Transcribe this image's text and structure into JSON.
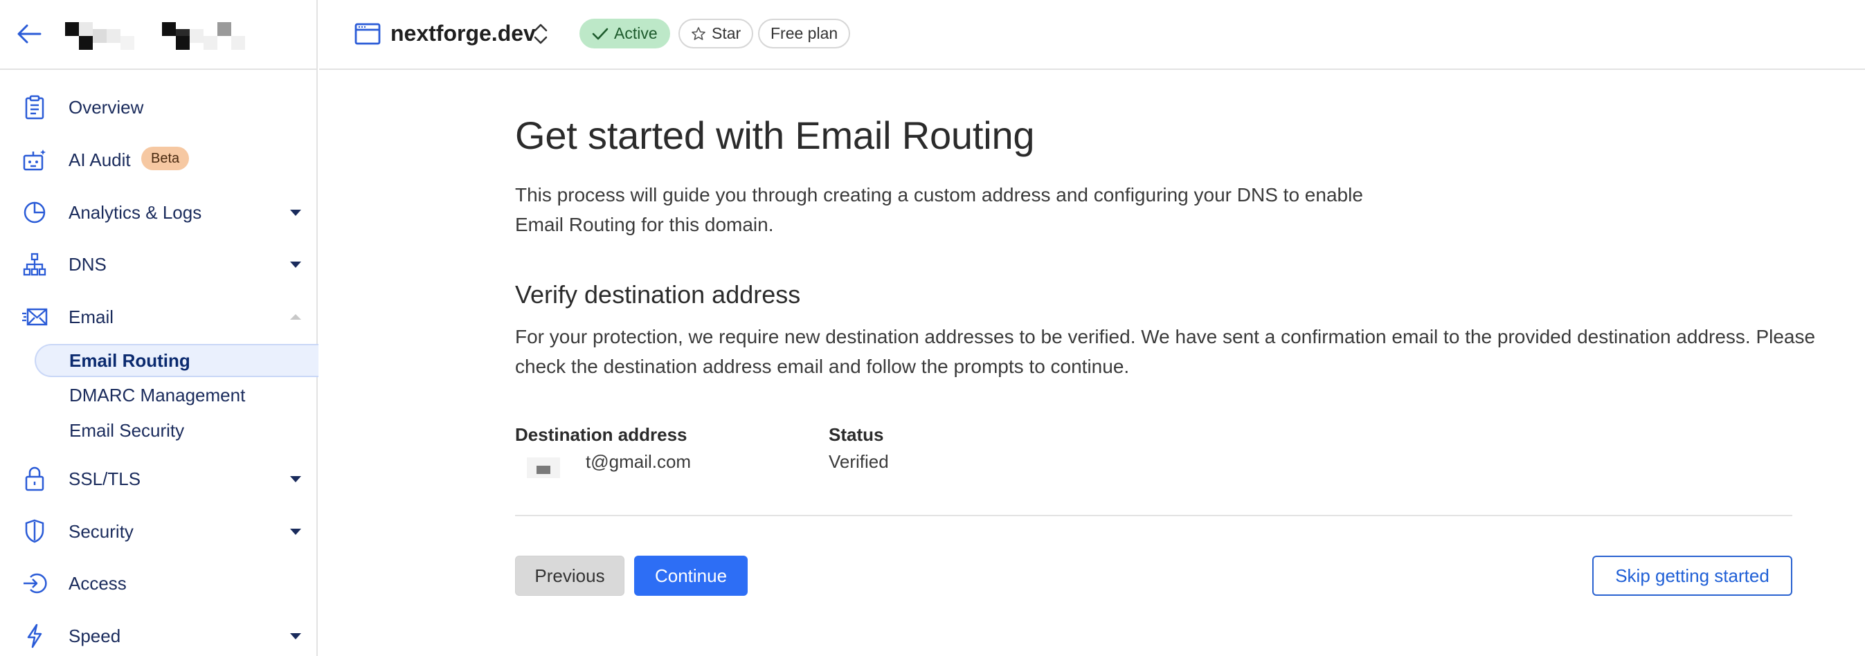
{
  "account": {
    "logo_alt": "account logo (obscured)"
  },
  "sidebar": {
    "items": [
      {
        "label": "Overview",
        "icon": "clipboard-icon"
      },
      {
        "label": "AI Audit",
        "icon": "robot-icon",
        "badge": "Beta"
      },
      {
        "label": "Analytics & Logs",
        "icon": "pie-chart-icon"
      },
      {
        "label": "DNS",
        "icon": "network-icon"
      },
      {
        "label": "Email",
        "icon": "email-icon"
      },
      {
        "label": "SSL/TLS",
        "icon": "lock-icon"
      },
      {
        "label": "Security",
        "icon": "shield-icon"
      },
      {
        "label": "Access",
        "icon": "access-icon"
      },
      {
        "label": "Speed",
        "icon": "bolt-icon"
      }
    ],
    "email_subitems": [
      "Email Routing",
      "DMARC Management",
      "Email Security"
    ]
  },
  "header": {
    "zone_name": "nextforge.dev",
    "status": "Active",
    "star_label": "Star",
    "plan": "Free plan"
  },
  "main": {
    "title": "Get started with Email Routing",
    "intro": "This process will guide you through creating a custom address and configuring your DNS to enable Email Routing for this domain.",
    "verify_title": "Verify destination address",
    "verify_text": "For your protection, we require new destination addresses to be verified. We have sent a confirmation email to the provided destination address. Please check the destination address email and follow the prompts to continue.",
    "table": {
      "headers": [
        "Destination address",
        "Status"
      ],
      "row": [
        "t@gmail.com",
        "Verified"
      ]
    },
    "buttons": {
      "previous": "Previous",
      "continue": "Continue",
      "skip": "Skip getting started"
    }
  },
  "colors": {
    "accent": "#2d6ef5",
    "nav_text": "#1a2b5c",
    "active_pill": "#bde8c8",
    "beta_badge": "#f6c8a2"
  }
}
